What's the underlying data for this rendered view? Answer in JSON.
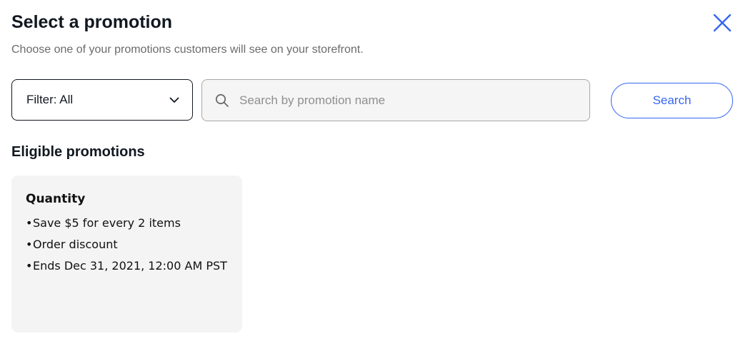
{
  "header": {
    "title": "Select a promotion",
    "subtitle": "Choose one of your promotions customers will see on your storefront.",
    "close_icon": "close-icon"
  },
  "filter": {
    "label": "Filter: All",
    "icon": "chevron-down-icon"
  },
  "search": {
    "placeholder": "Search by promotion name",
    "value": "",
    "icon": "search-icon",
    "button_label": "Search"
  },
  "eligible": {
    "heading": "Eligible promotions",
    "promotions": [
      {
        "title": "Quantity",
        "details": [
          "Save $5 for every 2 items",
          "Order discount",
          "Ends Dec 31, 2021, 12:00 AM PST"
        ]
      }
    ]
  },
  "colors": {
    "accent": "#3665f3",
    "text": "#111820",
    "muted_text": "#6b6b6b",
    "card_background": "#f4f4f4",
    "search_background": "#f5f5f5"
  }
}
